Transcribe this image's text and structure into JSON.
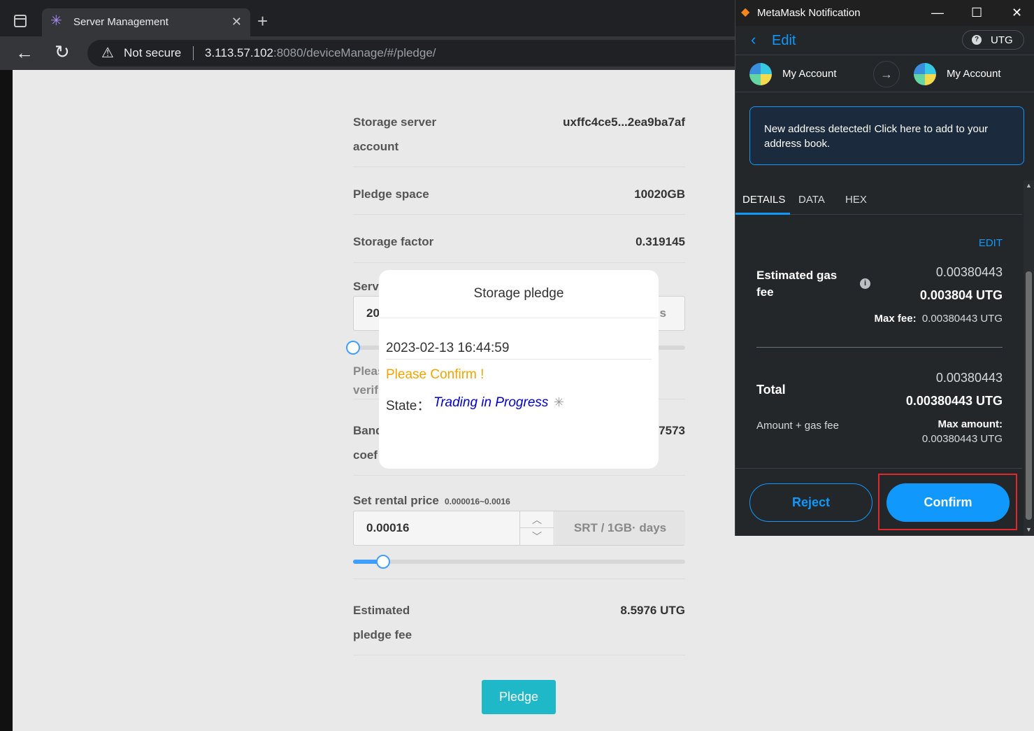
{
  "browser": {
    "tab_title": "Server Management",
    "security_label": "Not secure",
    "url_host": "3.113.57.102",
    "url_rest": ":8080/deviceManage/#/pledge/"
  },
  "form": {
    "account_label_line1": "Storage server",
    "account_label_line2": "account",
    "account_value": "uxffc4ce5...2ea9ba7af",
    "pledge_space_label": "Pledge space",
    "pledge_space_value": "10020GB",
    "storage_factor_label": "Storage factor",
    "storage_factor_value": "0.319145",
    "service_label_partial": "Serv",
    "service_input_partial": "20",
    "service_unit_partial": "s",
    "service_slider_level": 0.0,
    "verify_line1_partial": "Pleas",
    "verify_line2_partial": "verifi",
    "band_label_line1_partial": "Band",
    "band_label_line2_partial": "coef",
    "band_value_partial": "7573",
    "rental_label": "Set rental price",
    "rental_range": "0.000016~0.0016",
    "rental_value": "0.00016",
    "rental_unit": "SRT / 1GB· days",
    "rental_slider_level": 0.09,
    "est_fee_label_line1": "Estimated",
    "est_fee_label_line2": "pledge fee",
    "est_fee_value": "8.5976 UTG",
    "pledge_button": "Pledge"
  },
  "modal": {
    "title": "Storage pledge",
    "timestamp": "2023-02-13 16:44:59",
    "confirm_text": "Please Confirm !",
    "state_label": "State：",
    "state_value": "Trading in Progress"
  },
  "metamask": {
    "window_title": "MetaMask Notification",
    "header_edit": "Edit",
    "network": "UTG",
    "from_account": "My Account",
    "to_account": "My Account",
    "notice": "New address detected! Click here to add to your address book.",
    "tabs": [
      "DETAILS",
      "DATA",
      "HEX"
    ],
    "edit_link": "EDIT",
    "gas_label": "Estimated gas fee",
    "gas_fiat": "0.00380443",
    "gas_amount": "0.003804 UTG",
    "max_fee_label": "Max fee:",
    "max_fee_value": "0.00380443 UTG",
    "total_label": "Total",
    "total_fiat": "0.00380443",
    "total_amount": "0.00380443 UTG",
    "amount_gas_label": "Amount + gas fee",
    "max_amount_label": "Max amount:",
    "max_amount_value": "0.00380443 UTG",
    "reject_button": "Reject",
    "confirm_button": "Confirm"
  },
  "colors": {
    "accent_blue": "#1098fc",
    "pledge_teal": "#1fb8c9",
    "highlight_red": "#e0282d",
    "confirm_orange": "#f0a400"
  }
}
